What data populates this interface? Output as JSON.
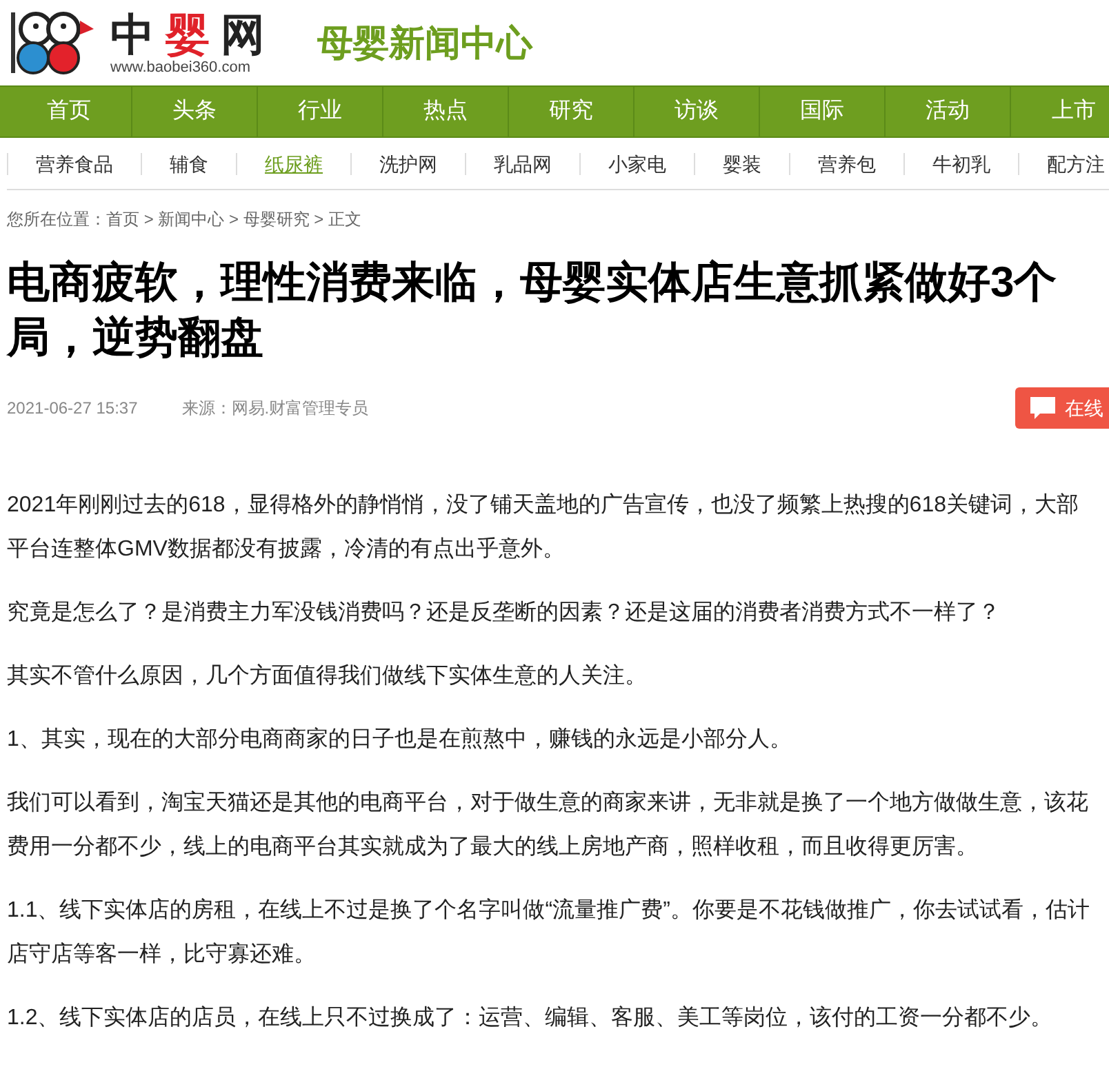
{
  "logo": {
    "parts": [
      {
        "text": "中",
        "accent": false
      },
      {
        "text": "婴",
        "accent": true
      },
      {
        "text": "网",
        "accent": false
      }
    ],
    "url": "www.baobei360.com"
  },
  "site_section": "母婴新闻中心",
  "nav": [
    "首页",
    "头条",
    "行业",
    "热点",
    "研究",
    "访谈",
    "国际",
    "活动",
    "上市"
  ],
  "subnav": [
    {
      "label": "营养食品",
      "selected": false
    },
    {
      "label": "辅食",
      "selected": false
    },
    {
      "label": "纸尿裤",
      "selected": true
    },
    {
      "label": "洗护网",
      "selected": false
    },
    {
      "label": "乳品网",
      "selected": false
    },
    {
      "label": "小家电",
      "selected": false
    },
    {
      "label": "婴装",
      "selected": false
    },
    {
      "label": "营养包",
      "selected": false
    },
    {
      "label": "牛初乳",
      "selected": false
    },
    {
      "label": "配方注",
      "selected": false
    }
  ],
  "breadcrumb": "您所在位置：首页 > 新闻中心 > 母婴研究 > 正文",
  "article": {
    "title_lines": [
      "电商疲软，理性消费来临，母婴实体店生意抓紧做好3个",
      "局，逆势翻盘"
    ],
    "date": "2021-06-27 15:37",
    "source": "来源：网易.财富管理专员",
    "chat_button": "在线",
    "paragraphs": [
      [
        "2021年刚刚过去的618，显得格外的静悄悄，没了铺天盖地的广告宣传，也没了频繁上热搜的618关键词，大部",
        "平台连整体GMV数据都没有披露，冷清的有点出乎意外。"
      ],
      [
        "究竟是怎么了？是消费主力军没钱消费吗？还是反垄断的因素？还是这届的消费者消费方式不一样了？"
      ],
      [
        "其实不管什么原因，几个方面值得我们做线下实体生意的人关注。"
      ],
      [
        "1、其实，现在的大部分电商商家的日子也是在煎熬中，赚钱的永远是小部分人。"
      ],
      [
        "我们可以看到，淘宝天猫还是其他的电商平台，对于做生意的商家来讲，无非就是换了一个地方做做生意，该花",
        "费用一分都不少，线上的电商平台其实就成为了最大的线上房地产商，照样收租，而且收得更厉害。"
      ],
      [
        "1.1、线下实体店的房租，在线上不过是换了个名字叫做“流量推广费”。你要是不花钱做推广，你去试试看，估计",
        "店守店等客一样，比守寡还难。"
      ],
      [
        "1.2、线下实体店的店员，在线上只不过换成了：运营、编辑、客服、美工等岗位，该付的工资一分都不少。"
      ]
    ]
  }
}
